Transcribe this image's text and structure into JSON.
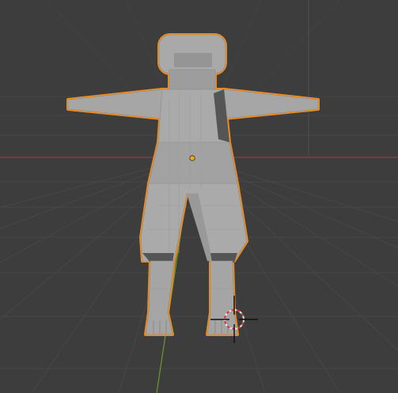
{
  "viewport": {
    "background_color": "#3d3d3d",
    "grid_color": "#4a4a4a",
    "x_axis_color": "#9b3b42",
    "y_axis_color": "#6b9a2a",
    "selection_outline_color": "#f08c1e",
    "origin_color": "#f5a623",
    "mesh_color": "#a8a8a8"
  },
  "scene": {
    "object": "humanoid-mesh",
    "selected": true,
    "view": "perspective-front",
    "cursor_icon": "3d-cursor-icon"
  }
}
